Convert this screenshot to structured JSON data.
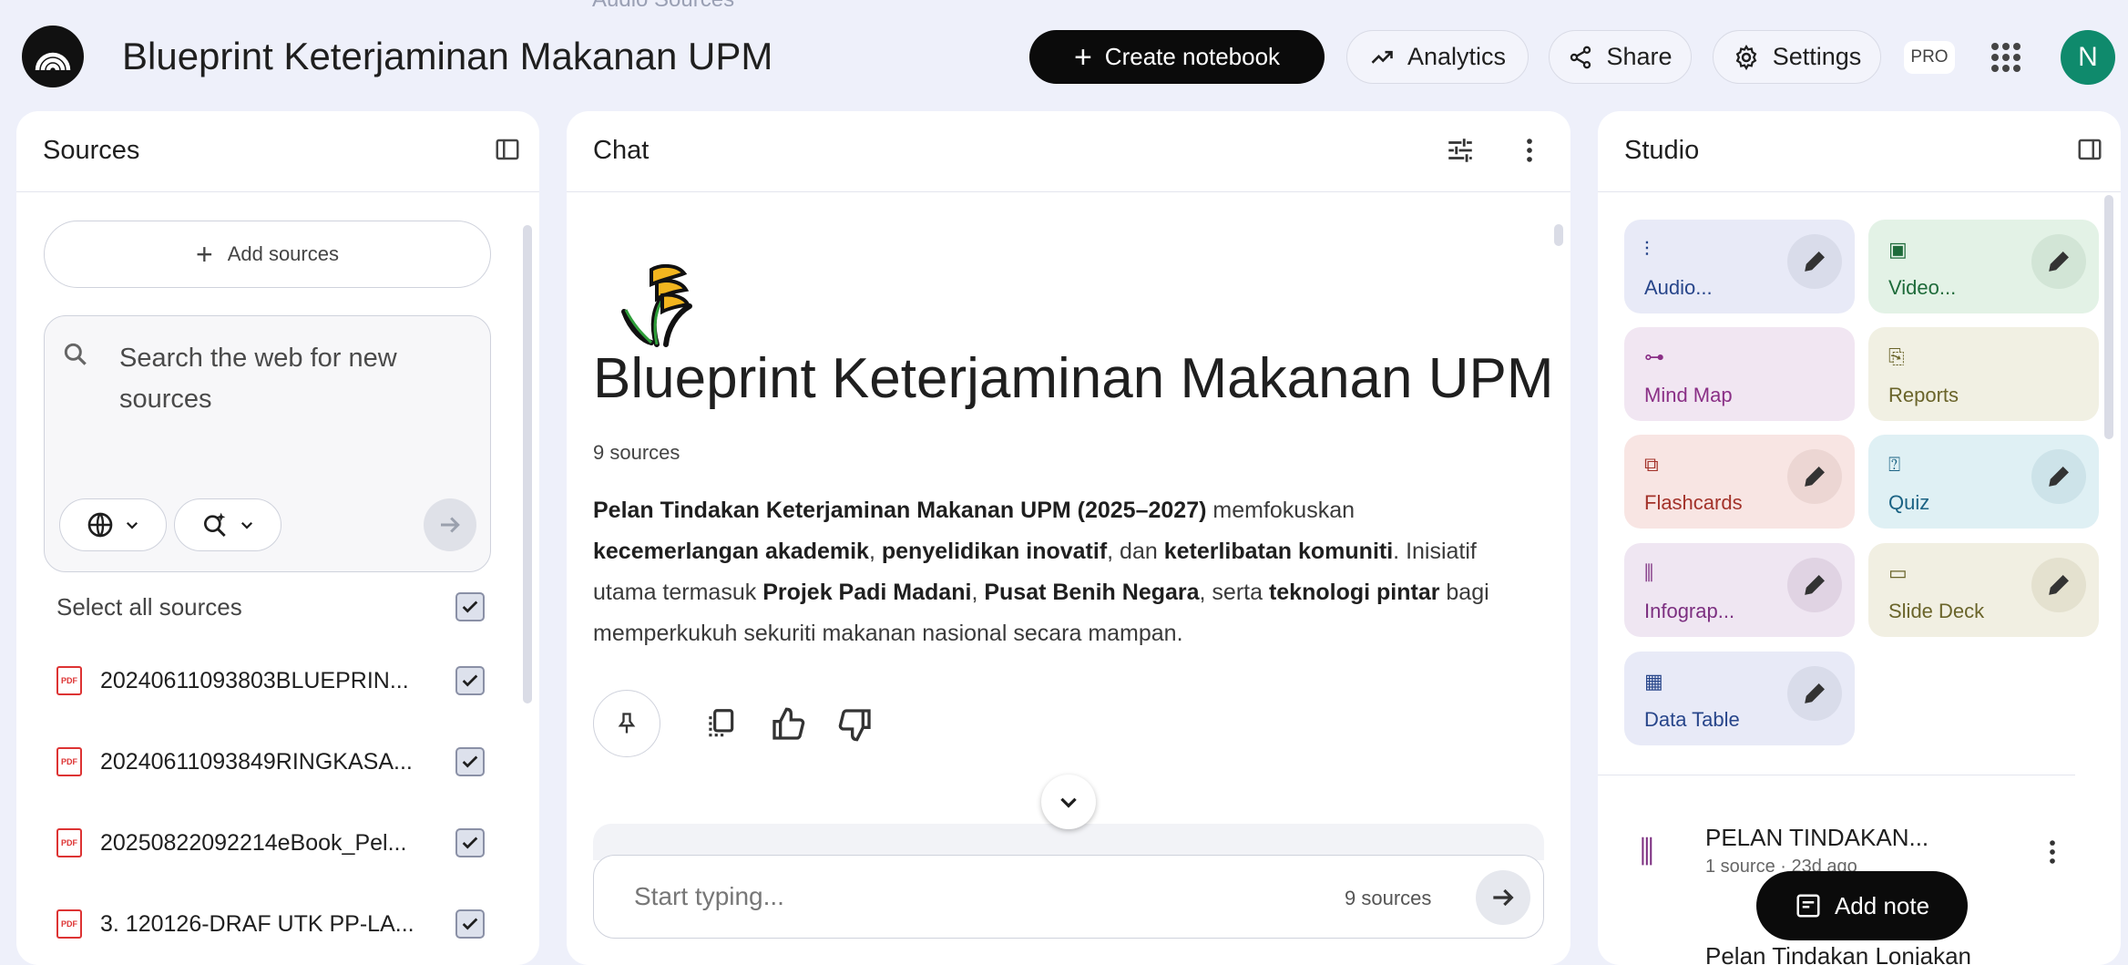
{
  "header": {
    "notebook_title": "Blueprint Keterjaminan Makanan UPM",
    "create_label": "Create notebook",
    "analytics_label": "Analytics",
    "share_label": "Share",
    "settings_label": "Settings",
    "pro_badge": "PRO",
    "avatar_initial": "N",
    "ghost_text": "Audio      Sources"
  },
  "sources": {
    "title": "Sources",
    "add_label": "Add sources",
    "search_placeholder": "Search the web for new sources",
    "select_all_label": "Select all sources",
    "items": [
      {
        "name": "20240611093803BLUEPRIN..."
      },
      {
        "name": "20240611093849RINGKASA..."
      },
      {
        "name": "20250822092214eBook_Pel..."
      },
      {
        "name": "3. 120126-DRAF UTK PP-LA..."
      }
    ]
  },
  "chat": {
    "title": "Chat",
    "notebook_title": "Blueprint Keterjaminan Makanan UPM",
    "source_count": "9 sources",
    "summary": {
      "s1": "Pelan Tindakan Keterjaminan Makanan UPM (2025–2027)",
      "s2": " memfokuskan ",
      "s3": "kecemerlangan akademik",
      "s4": ", ",
      "s5": "penyelidikan inovatif",
      "s6": ", dan ",
      "s7": "keterlibatan komuniti",
      "s8": ". Inisiatif utama termasuk ",
      "s9": "Projek Padi Madani",
      "s10": ", ",
      "s11": "Pusat Benih Negara",
      "s12": ", serta ",
      "s13": "teknologi pintar",
      "s14": " bagi memperkukuh sekuriti makanan nasional secara mampan."
    },
    "input_placeholder": "Start typing...",
    "input_source_count": "9 sources"
  },
  "studio": {
    "title": "Studio",
    "tiles": [
      {
        "label": "Audio...",
        "color": "#e8eaf7",
        "fg": "#27458a"
      },
      {
        "label": "Video...",
        "color": "#e3f2e6",
        "fg": "#1e6b3a"
      },
      {
        "label": "Mind Map",
        "color": "#f1e6f2",
        "fg": "#8a2f86"
      },
      {
        "label": "Reports",
        "color": "#f1f0e3",
        "fg": "#6a642a"
      },
      {
        "label": "Flashcards",
        "color": "#f8e5e3",
        "fg": "#a3322a"
      },
      {
        "label": "Quiz",
        "color": "#dff0f4",
        "fg": "#1b6384"
      },
      {
        "label": "Infograp...",
        "color": "#efe6f2",
        "fg": "#7c2f80"
      },
      {
        "label": "Slide Deck",
        "color": "#f1efe2",
        "fg": "#6a642a"
      },
      {
        "label": "Data Table",
        "color": "#e8eaf7",
        "fg": "#27458a"
      }
    ],
    "note": {
      "title": "PELAN TINDAKAN...",
      "meta": "1 source · 23d ago",
      "next_title": "Pelan Tindakan Lonjakan"
    },
    "add_note_label": "Add note"
  }
}
